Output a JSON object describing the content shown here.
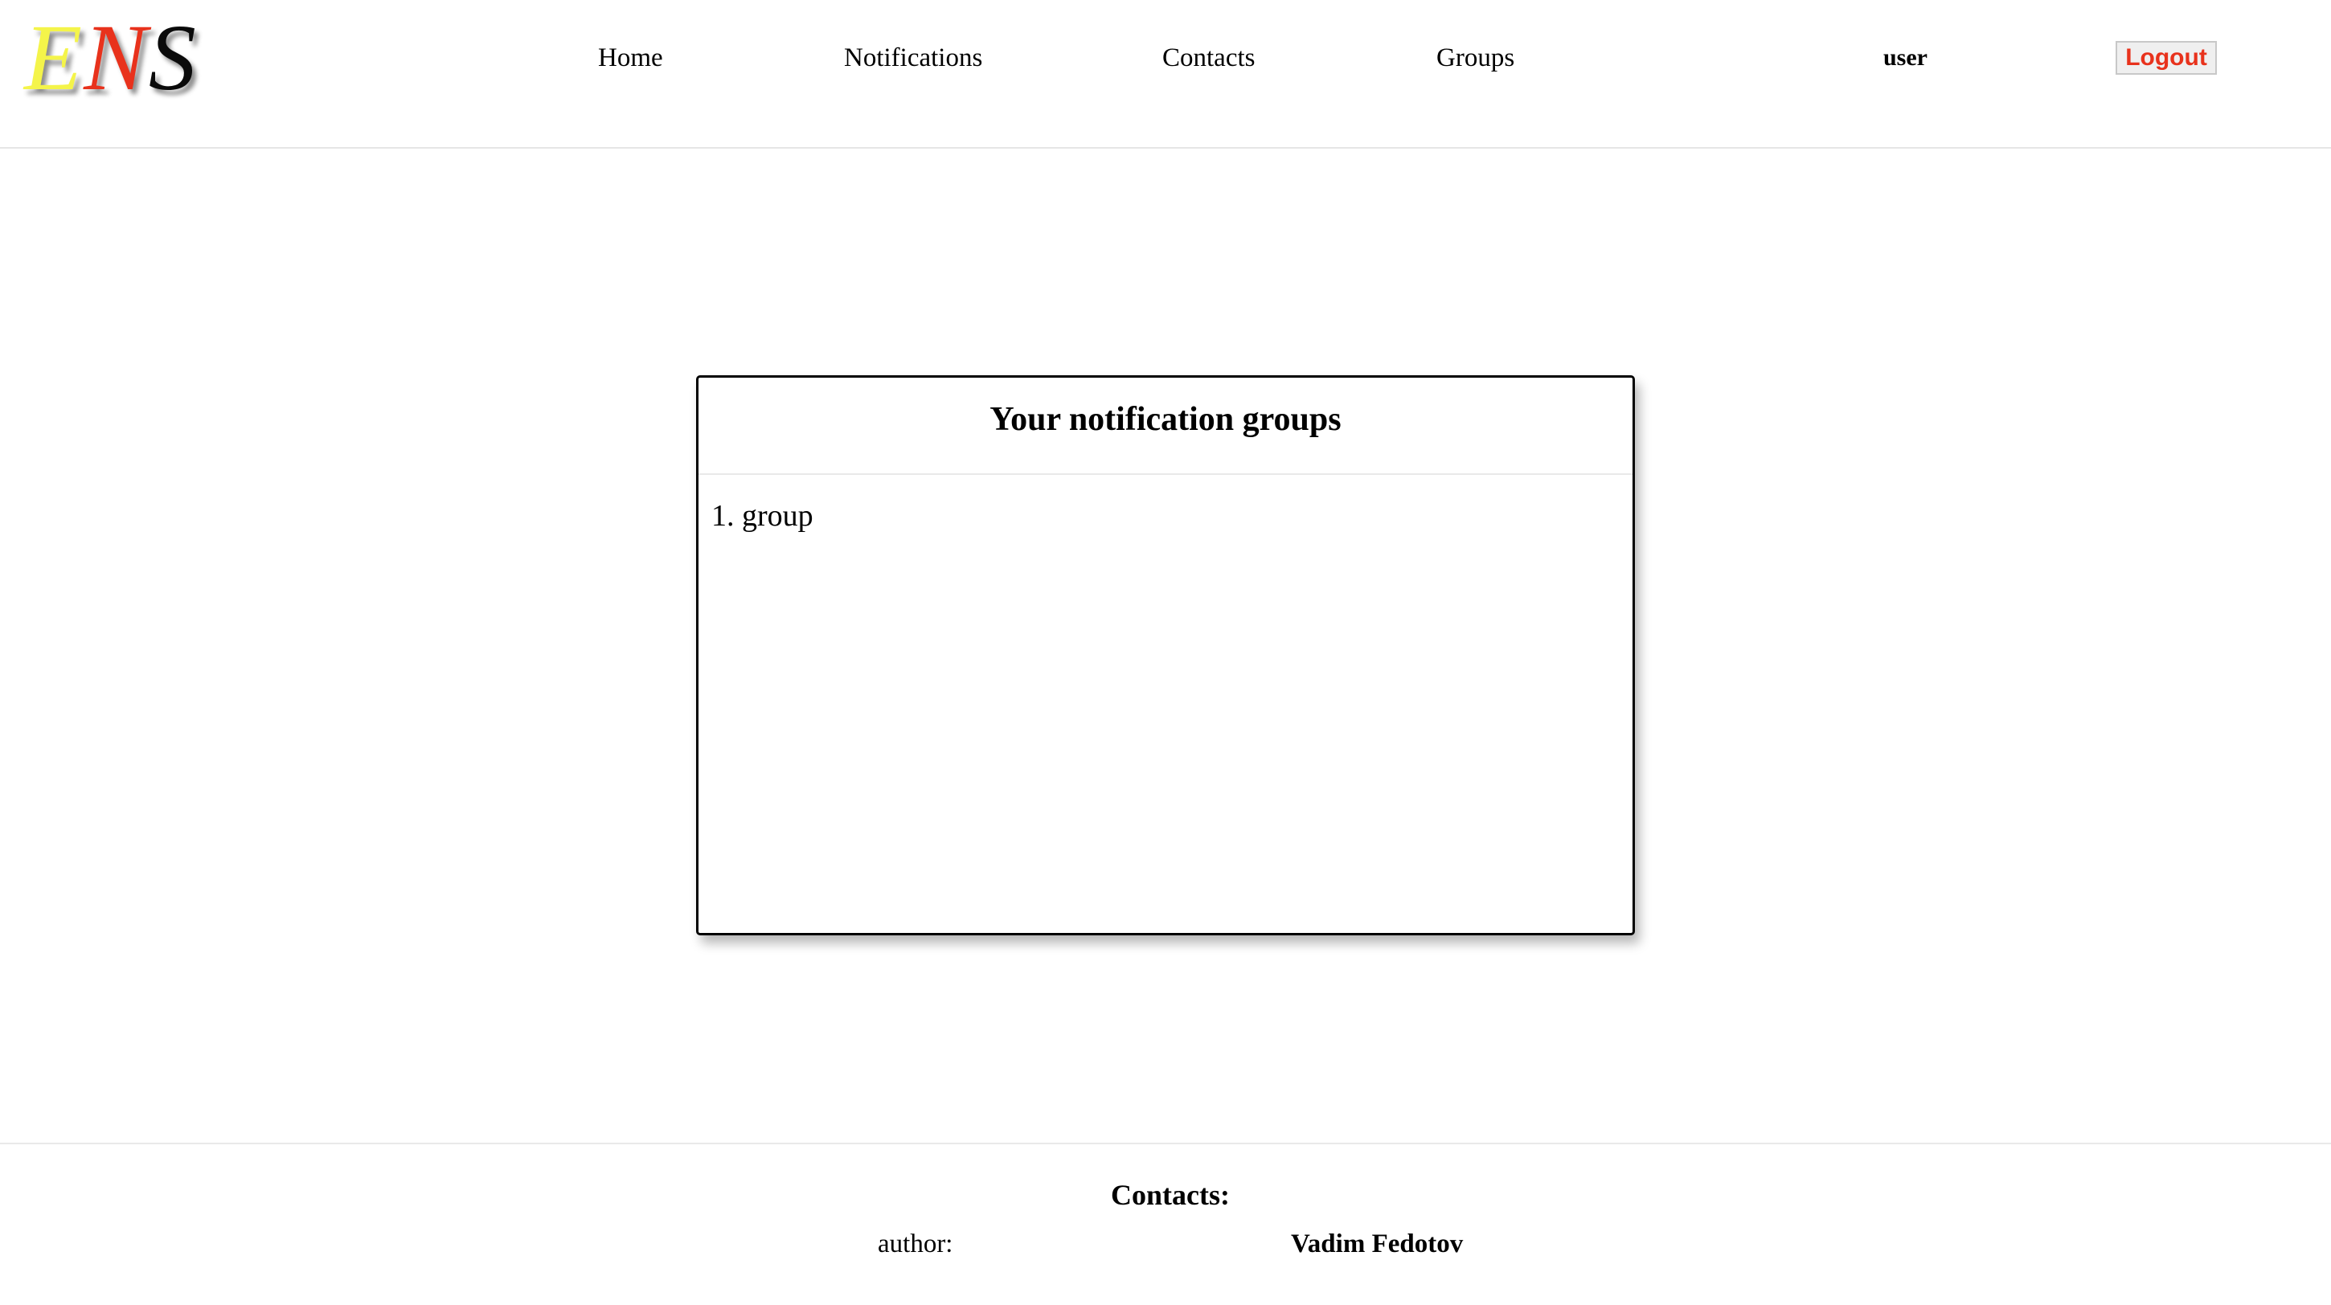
{
  "logo": {
    "letters": [
      "E",
      "N",
      "S"
    ],
    "colors": [
      "#f4f44a",
      "#e8321c",
      "#0a0a0a"
    ]
  },
  "nav": {
    "home": "Home",
    "notifications": "Notifications",
    "contacts": "Contacts",
    "groups": "Groups"
  },
  "user": {
    "name": "user",
    "logout_label": "Logout",
    "logout_color": "#e8321c"
  },
  "main": {
    "title": "Your notification groups",
    "groups": [
      {
        "number": "1.",
        "name": "group"
      }
    ]
  },
  "footer": {
    "title": "Contacts:",
    "author_label": "author:",
    "author_name": "Vadim Fedotov"
  }
}
